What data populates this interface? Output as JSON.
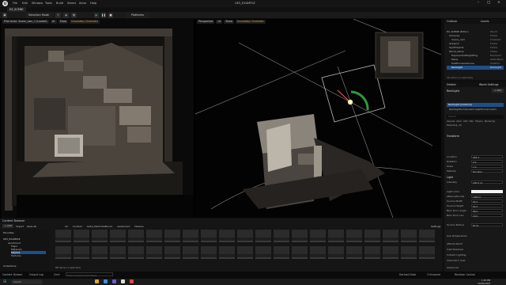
{
  "app": {
    "title": "UE5_EXAMPLE",
    "menu": [
      "File",
      "Edit",
      "Window",
      "Tools",
      "Build",
      "Select",
      "Actor",
      "Help"
    ],
    "level_tab": "EX_SCENE"
  },
  "toolbar": {
    "mode": "Selection Mode",
    "platforms": "Platforms"
  },
  "viewport_left": {
    "label": "Pilot Actor: Scene_cam_1 (Locked)",
    "view": "Lit",
    "show": "Show",
    "cinematic": "Unsuitably Cinematic"
  },
  "viewport_right": {
    "perspective": "Perspective",
    "view": "Lit",
    "show": "Show",
    "cinematic": "Unsuitably Cinematic"
  },
  "outliner": {
    "tab1": "Outliner",
    "tab2": "Levels",
    "items": [
      {
        "label": "EX_SCENE (Editor)",
        "type": "World"
      },
      {
        "label": "Cameras",
        "type": "Folder"
      },
      {
        "label": "Scene_cam",
        "type": "CineCam"
      },
      {
        "label": "Graybox",
        "type": "Folder"
      },
      {
        "label": "SpotTheArt1",
        "type": "Folder"
      },
      {
        "label": "World_setup",
        "type": "Folder"
      },
      {
        "label": "ExponentialHeightFog",
        "type": "Exponent"
      },
      {
        "label": "Plane",
        "type": "StaticMesh"
      },
      {
        "label": "PostProcessVolume",
        "type": "PostProc"
      },
      {
        "label": "RectLight",
        "type": "RectLight"
      }
    ],
    "count": "40 actors (1 selected)"
  },
  "details": {
    "tab1": "Details",
    "tab2": "World Settings",
    "actor": "RectLight",
    "add": "+ Add",
    "instance": "RectLight (Instance)",
    "component": "RectLightComponent (LightComponent)",
    "search": "Search",
    "filter_tabs": [
      "General",
      "Actor",
      "LOD",
      "Misc",
      "Physics",
      "Rendering",
      "Streaming",
      "All"
    ],
    "section_transform": "Transform",
    "rows": [
      {
        "label": "Location",
        "value": "284.3"
      },
      {
        "label": "Rotation",
        "value": "0.0"
      },
      {
        "label": "Scale",
        "value": "1.0"
      },
      {
        "label": "Mobility",
        "value": "Movable"
      }
    ],
    "section_light": "Light",
    "light_rows": [
      {
        "label": "Intensity",
        "value": "200.0 cd"
      },
      {
        "label": "Light Color",
        "value": ""
      },
      {
        "label": "Attenuation Ra",
        "value": "1000.0"
      },
      {
        "label": "Source Width",
        "value": "64.0"
      },
      {
        "label": "Source Height",
        "value": "64.0"
      },
      {
        "label": "Barn Door Angle",
        "value": "88.0"
      },
      {
        "label": "Barn Door Len",
        "value": "20.0"
      },
      {
        "label": "Source Texture",
        "value": "None"
      }
    ],
    "more_rows": [
      "Use Temperature",
      "Affects World",
      "Cast Shadows",
      "Indirect Lighting",
      "Volumetric Scat",
      "Advanced"
    ]
  },
  "content_browser": {
    "title": "Content Browser",
    "add": "+ Add",
    "import": "Import",
    "save_all": "Save All",
    "path": [
      "All",
      "Content",
      "Gaba_MedUrbeBlocks",
      "Apartment",
      "Meshes"
    ],
    "settings": "Settings",
    "favorites": "Favorites",
    "project": "UE5_EXAMPLE",
    "folders": [
      "Apartment",
      "Maps",
      "Materials",
      "Meshes",
      "Textures"
    ],
    "collections": "Collections",
    "count": "88 items (1 selected)"
  },
  "status": {
    "drawer": "Content Drawer",
    "output": "Output Log",
    "cmd": "Cmd",
    "input_placeholder": "Enter Console Command",
    "derived": "Derived Data",
    "unsaved": "3 Unsaved",
    "revision": "Revision Control"
  },
  "taskbar": {
    "search": "Search",
    "time": "1:45 PM",
    "date": "10/26/2023"
  }
}
